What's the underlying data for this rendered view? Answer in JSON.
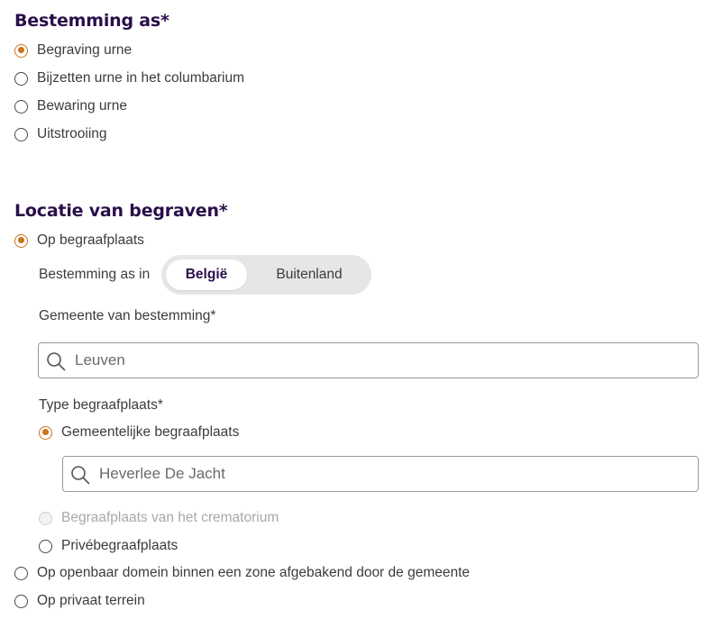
{
  "section1": {
    "title": "Bestemming as*",
    "options": [
      {
        "label": "Begraving urne",
        "checked": true
      },
      {
        "label": "Bijzetten urne in het columbarium",
        "checked": false
      },
      {
        "label": "Bewaring urne",
        "checked": false
      },
      {
        "label": "Uitstrooiing",
        "checked": false
      }
    ]
  },
  "section2": {
    "title": "Locatie van begraven*",
    "option_cemetery": "Op begraafplaats",
    "destination_label": "Bestemming as in",
    "toggle": {
      "active": "België",
      "inactive": "Buitenland"
    },
    "municipality": {
      "label": "Gemeente van bestemming*",
      "value": "Leuven"
    },
    "cemetery_type": {
      "label": "Type begraafplaats*",
      "municipal": "Gemeentelijke begraafplaats",
      "municipal_search_value": "Heverlee De Jacht",
      "crematorium": "Begraafplaats van het crematorium",
      "private_cemetery": "Privébegraafplaats"
    },
    "option_public_domain": "Op openbaar domein binnen een zone afgebakend door de gemeente",
    "option_private_land": "Op privaat terrein"
  },
  "colors": {
    "accent": "#c9741a",
    "heading": "#2a0f4a"
  },
  "icons": {
    "search": "search-icon"
  }
}
